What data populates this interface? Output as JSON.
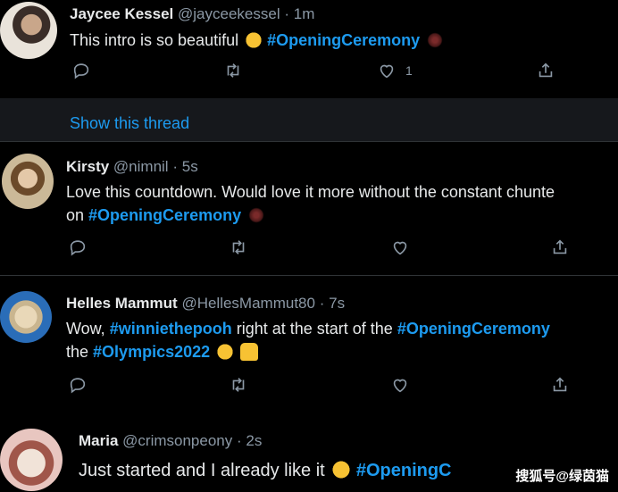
{
  "tweets": [
    {
      "name": "Jaycee Kessel",
      "handle": "@jayceekessel",
      "time": "1m",
      "text_plain": "This intro is so beautiful",
      "hashtag": "#OpeningCeremony",
      "likes": "1"
    },
    {
      "name": "Kirsty",
      "handle": "@nimnil",
      "time": "5s",
      "text_line1": "Love this countdown. Would love it more without the constant chunte",
      "text_line2_prefix": "on",
      "hashtag": "#OpeningCeremony"
    },
    {
      "name": "Helles Mammut",
      "handle": "@HellesMammut80",
      "time": "7s",
      "line1_prefix": "Wow,",
      "hashtag1": "#winniethepooh",
      "line1_middle": "right at the start of the",
      "hashtag2": "#OpeningCeremony",
      "line2_prefix": "the",
      "hashtag3": "#Olympics2022"
    },
    {
      "name": "Maria",
      "handle": "@crimsonpeony",
      "time": "2s",
      "text_plain": "Just started and I already like it",
      "hashtag": "#OpeningC"
    }
  ],
  "thread_link": "Show this thread",
  "separator": "·",
  "watermark": "搜狐号@绿茵猫",
  "icons": [
    "reply-icon",
    "retweet-icon",
    "like-icon",
    "share-icon"
  ],
  "colors": {
    "background": "#000000",
    "link": "#1d9bf0",
    "muted": "#8b98a5"
  }
}
